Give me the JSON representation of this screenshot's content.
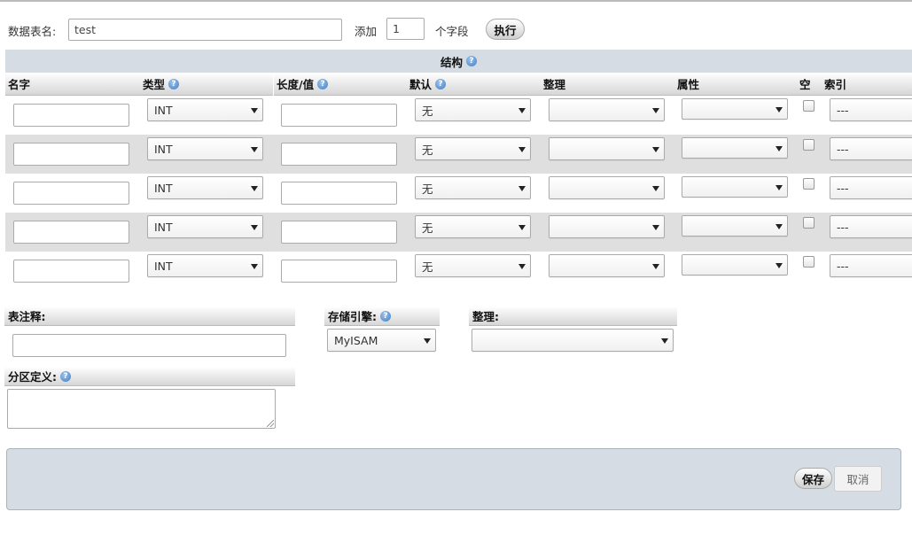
{
  "header": {
    "table_name_label": "数据表名:",
    "table_name_value": "test",
    "add_label": "添加",
    "add_count": "1",
    "fields_label": "个字段",
    "go_button": "执行"
  },
  "structure": {
    "title": "结构",
    "columns": {
      "name": "名字",
      "type": "类型",
      "length": "长度/值",
      "default": "默认",
      "collation": "整理",
      "attributes": "属性",
      "null": "空",
      "index": "索引"
    },
    "rows": [
      {
        "name": "",
        "type": "INT",
        "length": "",
        "default": "无",
        "collation": "",
        "attributes": "",
        "index": "---"
      },
      {
        "name": "",
        "type": "INT",
        "length": "",
        "default": "无",
        "collation": "",
        "attributes": "",
        "index": "---"
      },
      {
        "name": "",
        "type": "INT",
        "length": "",
        "default": "无",
        "collation": "",
        "attributes": "",
        "index": "---"
      },
      {
        "name": "",
        "type": "INT",
        "length": "",
        "default": "无",
        "collation": "",
        "attributes": "",
        "index": "---"
      },
      {
        "name": "",
        "type": "INT",
        "length": "",
        "default": "无",
        "collation": "",
        "attributes": "",
        "index": "---"
      }
    ]
  },
  "options": {
    "comment_label": "表注释:",
    "comment_value": "",
    "engine_label": "存储引擎:",
    "engine_value": "MyISAM",
    "collation_label": "整理:",
    "collation_value": "",
    "partition_label": "分区定义:"
  },
  "footer": {
    "save_button": "保存",
    "cancel_button": "取消"
  },
  "icons": {
    "help": "help-icon",
    "dropdown": "chevron-down-icon"
  },
  "colors": {
    "structure_bar": "#d5dce3",
    "row_alt": "#dfdfdf",
    "help_icon": "#3f7dc4"
  }
}
